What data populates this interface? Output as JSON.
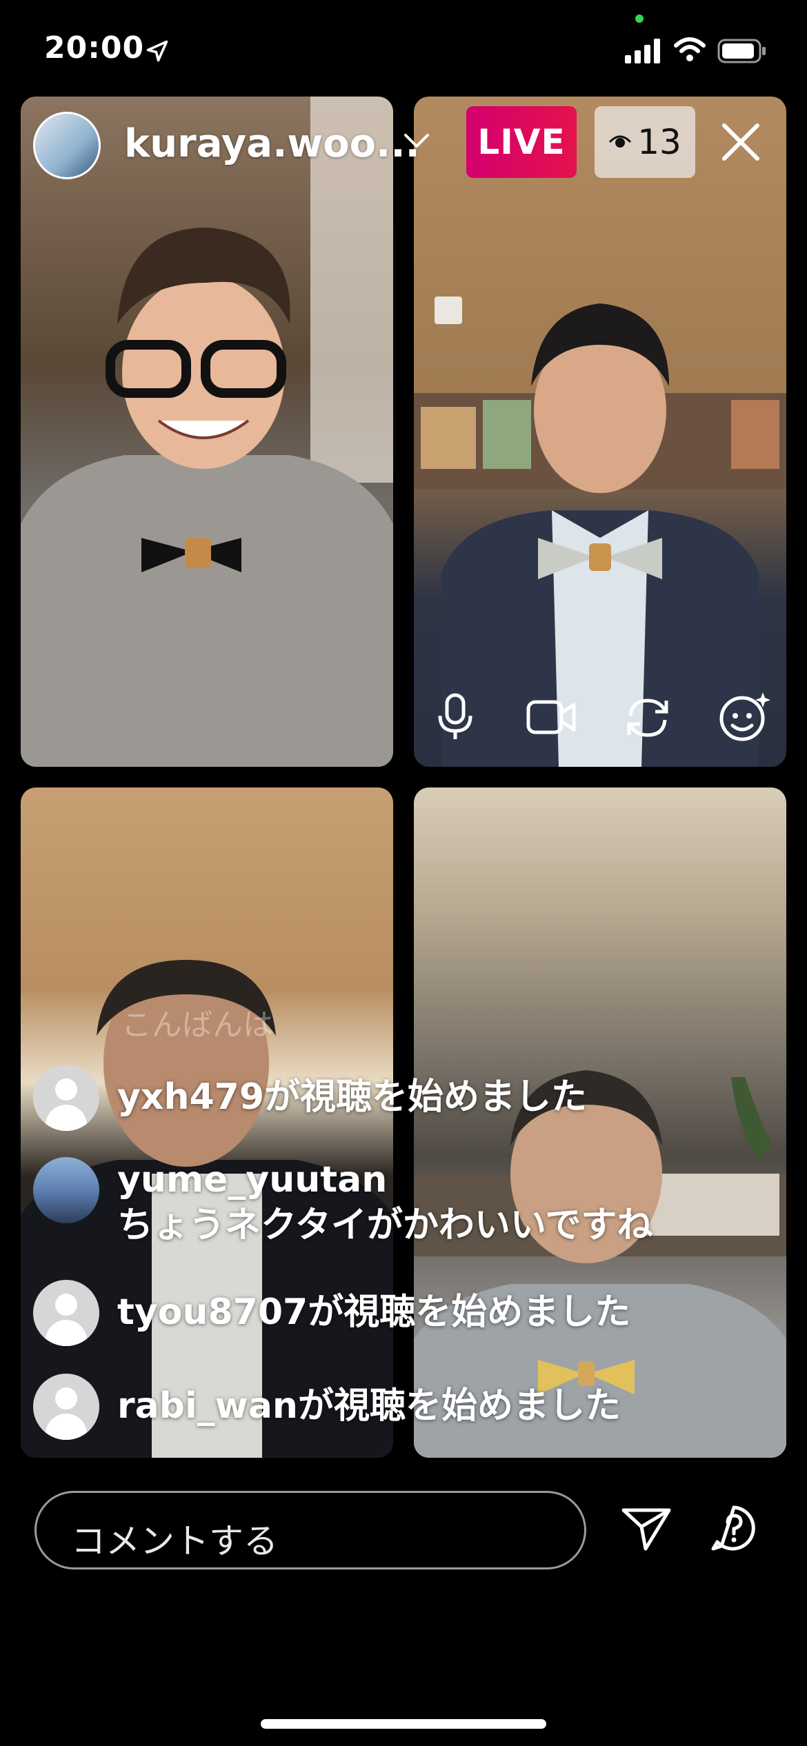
{
  "status_bar": {
    "time": "20:00"
  },
  "header": {
    "host_username": "kuraya.woo...",
    "live_label": "LIVE",
    "viewer_count": "13"
  },
  "comments": {
    "faded_text": "こんばんは",
    "items": [
      {
        "user": "yxh479",
        "message": "が視聴を始めました"
      },
      {
        "user": "yume_yuutan",
        "message": "ちょうネクタイがかわいいですね"
      },
      {
        "user": "tyou8707",
        "message": "が視聴を始めました"
      },
      {
        "user": "rabi_wan",
        "message": "が視聴を始めました"
      }
    ]
  },
  "comment_input": {
    "placeholder": "コメントする"
  },
  "colors": {
    "live_gradient_start": "#d3006f",
    "live_gradient_end": "#e5124d"
  }
}
